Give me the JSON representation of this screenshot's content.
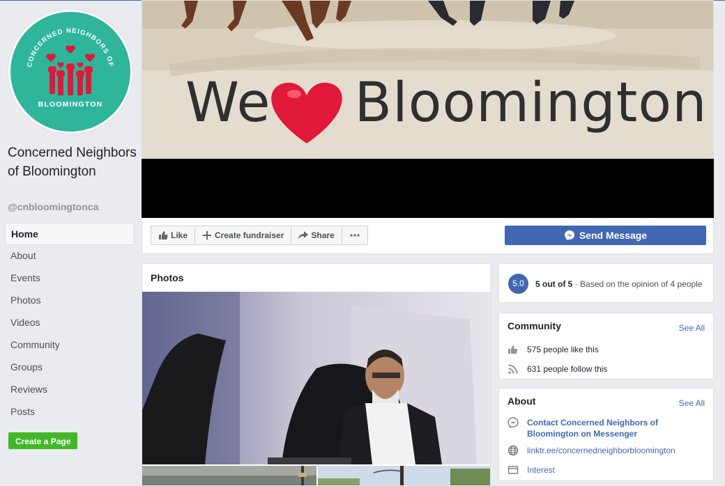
{
  "page": {
    "name": "Concerned Neighbors of Bloomington",
    "handle": "@cnbloomingtonca",
    "logo_text_top": "CONCERNED NEIGHBORS OF",
    "logo_text_bottom": "BLOOMINGTON"
  },
  "cover": {
    "text_left": "We",
    "text_right": "Bloomington"
  },
  "nav": {
    "items": [
      {
        "label": "Home",
        "active": true
      },
      {
        "label": "About"
      },
      {
        "label": "Events"
      },
      {
        "label": "Photos"
      },
      {
        "label": "Videos"
      },
      {
        "label": "Community"
      },
      {
        "label": "Groups"
      },
      {
        "label": "Reviews"
      },
      {
        "label": "Posts"
      }
    ],
    "create_page": "Create a Page"
  },
  "actions": {
    "like": "Like",
    "fundraiser": "Create fundraiser",
    "share": "Share",
    "send_message": "Send Message"
  },
  "photos": {
    "title": "Photos"
  },
  "rating": {
    "score": "5.0",
    "headline": "5 out of 5",
    "detail": "· Based on the opinion of 4 people"
  },
  "community": {
    "title": "Community",
    "see_all": "See All",
    "likes": "575 people like this",
    "follows": "631 people follow this"
  },
  "about": {
    "title": "About",
    "see_all": "See All",
    "messenger": "Contact Concerned Neighbors of Bloomington on Messenger",
    "website": "linktr.ee/concernedneighborbloomington",
    "category": "Interest"
  },
  "colors": {
    "brand_blue": "#4267b2",
    "logo_teal": "#2fb59b",
    "heart_red": "#e0183a",
    "create_green": "#42b72a"
  }
}
